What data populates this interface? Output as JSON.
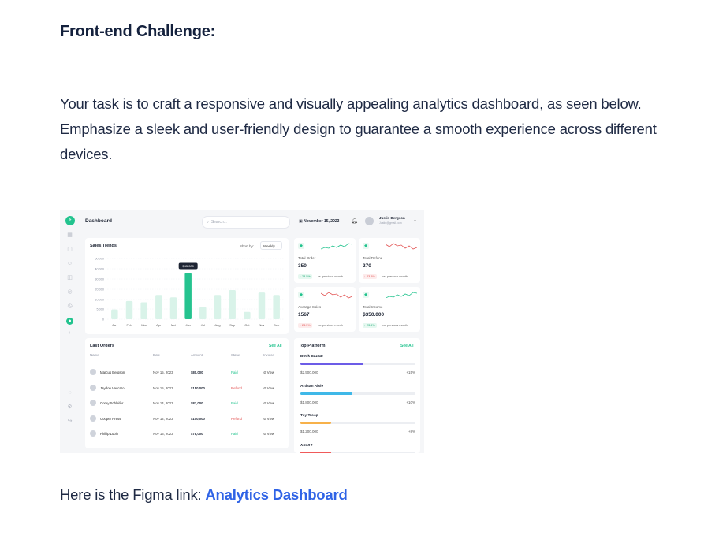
{
  "heading": "Front-end Challenge:",
  "intro": "Your task is to craft a responsive and visually appealing analytics dashboard, as seen below. Emphasize a sleek and user-friendly design to guarantee a smooth experience across different devices.",
  "figma_prefix": "Here is the Figma link: ",
  "figma_link_text": "Analytics Dashboard",
  "dashboard": {
    "title": "Dashboard",
    "search_placeholder": "Search...",
    "date": "November 15, 2023",
    "user": {
      "name": "Justin Bergson",
      "email": "Justin@gmail.com"
    },
    "sidebar_icons": [
      "grid-icon",
      "doc-icon",
      "users-icon",
      "box-icon",
      "settings-icon",
      "clock-icon",
      "active-icon",
      "moon-icon",
      "info-icon",
      "gear-icon",
      "logout-icon"
    ],
    "sales_trends": {
      "title": "Sales Trends",
      "sort_label": "Short by:",
      "sort_value": "Weekly",
      "tooltip": "$45.000"
    },
    "stats": [
      {
        "label": "Total Order",
        "value": "350",
        "change": "↑ 23.5%",
        "direction": "up",
        "vs": "vs. previous month"
      },
      {
        "label": "Total Refund",
        "value": "270",
        "change": "↓ 23.5%",
        "direction": "down",
        "vs": "vs. previous month"
      },
      {
        "label": "Average Sales",
        "value": "1567",
        "change": "↓ 23.5%",
        "direction": "down",
        "vs": "vs. previous month"
      },
      {
        "label": "Total Income",
        "value": "$350.000",
        "change": "↑ 23.5%",
        "direction": "up",
        "vs": "vs. previous month"
      }
    ],
    "last_orders": {
      "title": "Last Orders",
      "see_all": "See All",
      "headers": [
        "Name",
        "Date",
        "Amount",
        "Status",
        "Invoice"
      ],
      "rows": [
        {
          "name": "Marcus Bergson",
          "date": "Nov 15, 2023",
          "amount": "$80,000",
          "status": "Paid",
          "invoice": "View"
        },
        {
          "name": "Jaydon Vaccaro",
          "date": "Nov 15, 2023",
          "amount": "$150,000",
          "status": "Refund",
          "invoice": "View"
        },
        {
          "name": "Corey Schleifer",
          "date": "Nov 14, 2023",
          "amount": "$87,000",
          "status": "Paid",
          "invoice": "View"
        },
        {
          "name": "Cooper Press",
          "date": "Nov 14, 2023",
          "amount": "$100,000",
          "status": "Refund",
          "invoice": "View"
        },
        {
          "name": "Phillip Lubin",
          "date": "Nov 13, 2023",
          "amount": "$78,000",
          "status": "Paid",
          "invoice": "View"
        }
      ]
    },
    "top_platform": {
      "title": "Top Platform",
      "see_all": "See All",
      "items": [
        {
          "name": "Book Bazaar",
          "value": "$2,500,000",
          "percent": "+15%",
          "fill": 0.55,
          "color": "#6c5ce7"
        },
        {
          "name": "Artisan Aisle",
          "value": "$1,800,000",
          "percent": "+10%",
          "fill": 0.45,
          "color": "#3fb8e8"
        },
        {
          "name": "Toy Troop",
          "value": "$1,200,000",
          "percent": "+8%",
          "fill": 0.27,
          "color": "#f7b14a"
        },
        {
          "name": "XStore",
          "value": "",
          "percent": "",
          "fill": 0.27,
          "color": "#f05a5a"
        }
      ]
    }
  },
  "chart_data": {
    "type": "bar",
    "title": "Sales Trends",
    "categories": [
      "Jan",
      "Feb",
      "Mar",
      "Apr",
      "Mei",
      "Jun",
      "Jul",
      "Aug",
      "Sep",
      "Oct",
      "Nov",
      "Dec"
    ],
    "values": [
      8000,
      15000,
      14000,
      20000,
      18000,
      38000,
      10000,
      20000,
      24000,
      6000,
      22000,
      20000
    ],
    "highlight_index": 5,
    "y_ticks": [
      "50.000",
      "40.000",
      "30.000",
      "20.000",
      "10.000",
      "5.000",
      "0"
    ],
    "ylim": [
      0,
      50000
    ],
    "grid": true
  }
}
